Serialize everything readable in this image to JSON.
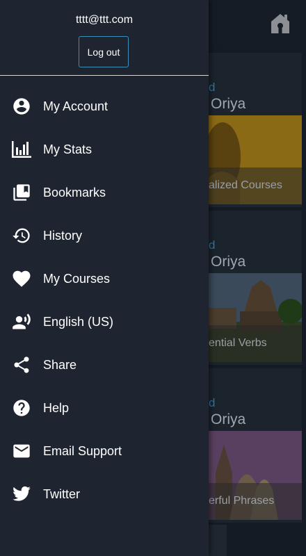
{
  "drawer": {
    "user_email": "tttt@ttt.com",
    "logout_label": "Log out",
    "items": [
      {
        "label": "My Account",
        "icon": "account-circle-icon"
      },
      {
        "label": "My Stats",
        "icon": "bar-chart-icon"
      },
      {
        "label": "Bookmarks",
        "icon": "bookmarks-icon"
      },
      {
        "label": "History",
        "icon": "history-icon"
      },
      {
        "label": "My Courses",
        "icon": "heart-icon"
      },
      {
        "label": "English (US)",
        "icon": "voice-language-icon"
      },
      {
        "label": "Share",
        "icon": "share-icon"
      },
      {
        "label": "Help",
        "icon": "help-icon"
      },
      {
        "label": "Email Support",
        "icon": "email-icon"
      },
      {
        "label": "Twitter",
        "icon": "twitter-icon"
      }
    ]
  },
  "background": {
    "cards": [
      {
        "level": "d",
        "language": "Oriya",
        "caption": "alized Courses"
      },
      {
        "level": "d",
        "language": "Oriya",
        "caption": "ential Verbs"
      },
      {
        "level": "d",
        "language": "Oriya",
        "caption": "erful Phrases"
      }
    ]
  },
  "colors": {
    "drawer_bg": "#1f2530",
    "accent": "#3c90b8",
    "level_text": "#2f79a5"
  }
}
